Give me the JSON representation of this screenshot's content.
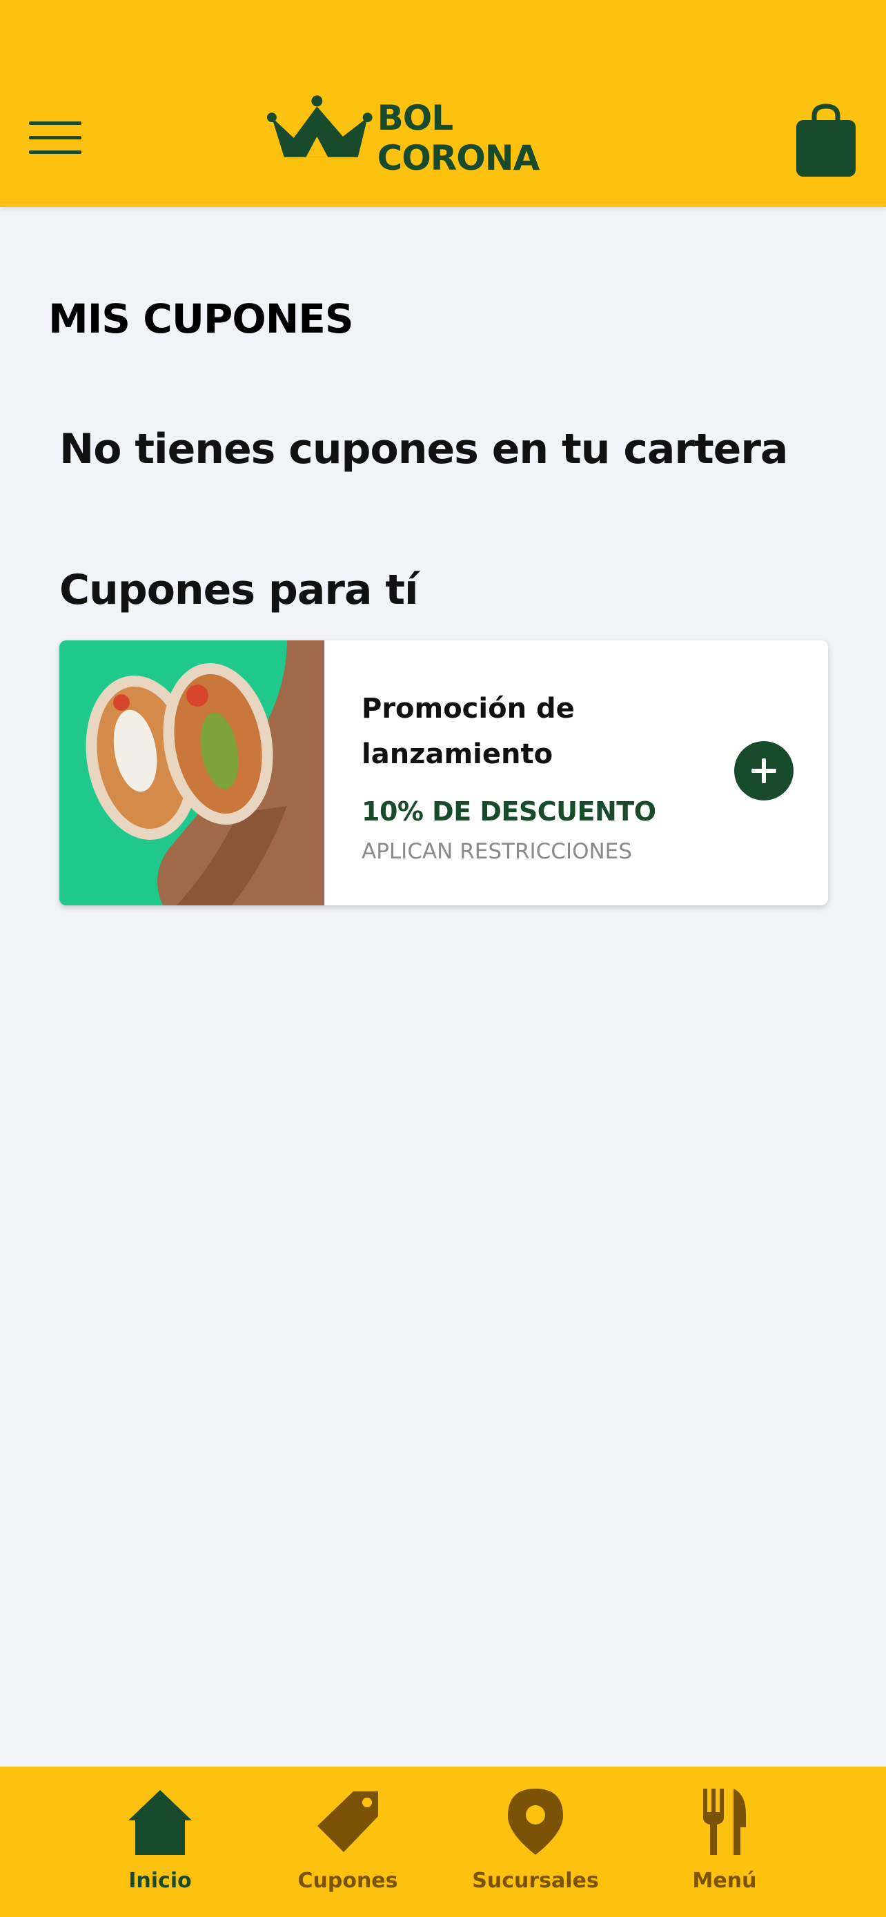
{
  "header": {
    "brand": "BOL CORONA",
    "menu_icon": "hamburger-menu-icon",
    "cart_icon": "shopping-bag-icon",
    "background_color": "#fdc20f",
    "accent_color": "#184a2c"
  },
  "page": {
    "title": "MIS CUPONES",
    "empty_message": "No tienes cupones en tu cartera",
    "section_title": "Cupones para tí"
  },
  "coupons": [
    {
      "title": "Promoción de lanzamiento",
      "discount": "10% DE DESCUENTO",
      "restrictions": "APLICAN RESTRICCIONES",
      "image": "burrito-photo",
      "image_background": "#20c98b",
      "action_icon": "plus-icon"
    }
  ],
  "bottom_nav": {
    "items": [
      {
        "label": "Inicio",
        "icon": "home-icon",
        "active": true
      },
      {
        "label": "Cupones",
        "icon": "tag-icon",
        "active": false
      },
      {
        "label": "Sucursales",
        "icon": "location-pin-icon",
        "active": false
      },
      {
        "label": "Menú",
        "icon": "fork-knife-icon",
        "active": false
      }
    ]
  }
}
